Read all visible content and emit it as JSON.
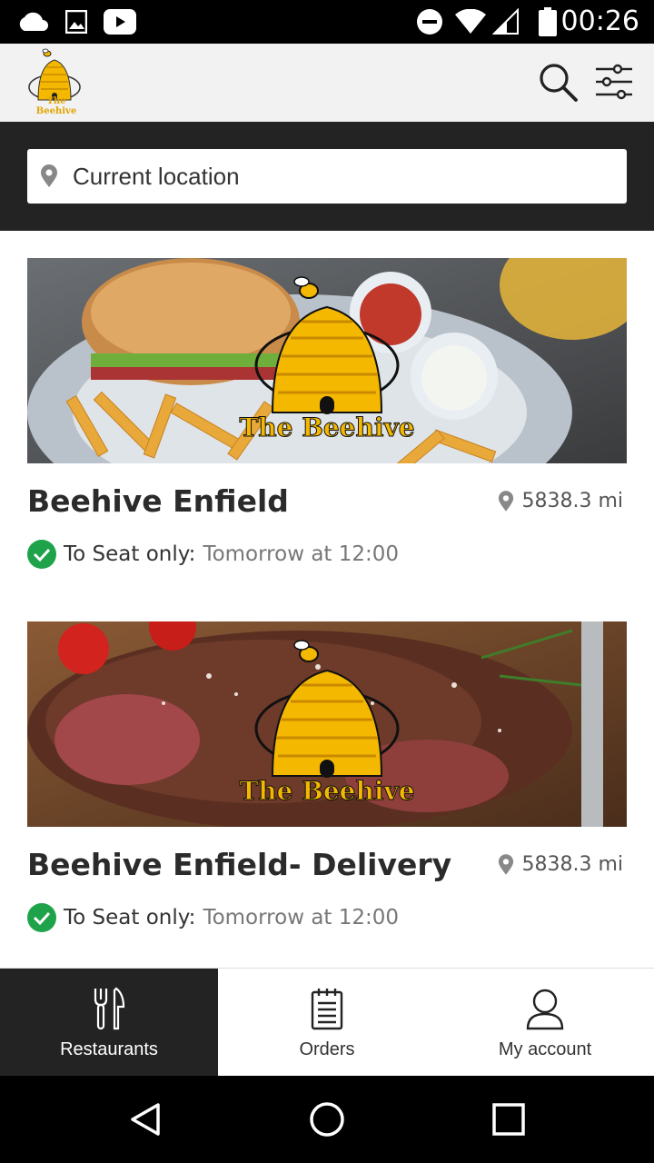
{
  "status_bar": {
    "time": "00:26",
    "icons": [
      "cloud-icon",
      "image-icon",
      "youtube-icon",
      "do-not-disturb-icon",
      "wifi-icon",
      "signal-icon",
      "battery-icon"
    ]
  },
  "app_bar": {
    "logo_text": "The Beehive",
    "icons": [
      "search-icon",
      "filter-icon"
    ]
  },
  "search": {
    "placeholder": "Current location",
    "value": "Current location"
  },
  "restaurants": [
    {
      "name": "Beehive Enfield",
      "distance": "5838.3 mi",
      "status_label": "To Seat only:",
      "status_time": "Tomorrow at 12:00",
      "logo_text": "The Beehive"
    },
    {
      "name": "Beehive Enfield- Delivery",
      "distance": "5838.3 mi",
      "status_label": "To Seat only:",
      "status_time": "Tomorrow at 12:00",
      "logo_text": "The Beehive"
    }
  ],
  "bottom_nav": {
    "items": [
      {
        "label": "Restaurants",
        "icon": "cutlery-icon",
        "active": true
      },
      {
        "label": "Orders",
        "icon": "notepad-icon",
        "active": false
      },
      {
        "label": "My account",
        "icon": "person-icon",
        "active": false
      }
    ]
  },
  "colors": {
    "dark": "#232323",
    "accent_green": "#1fa34a",
    "beehive_yellow": "#f5b800"
  }
}
